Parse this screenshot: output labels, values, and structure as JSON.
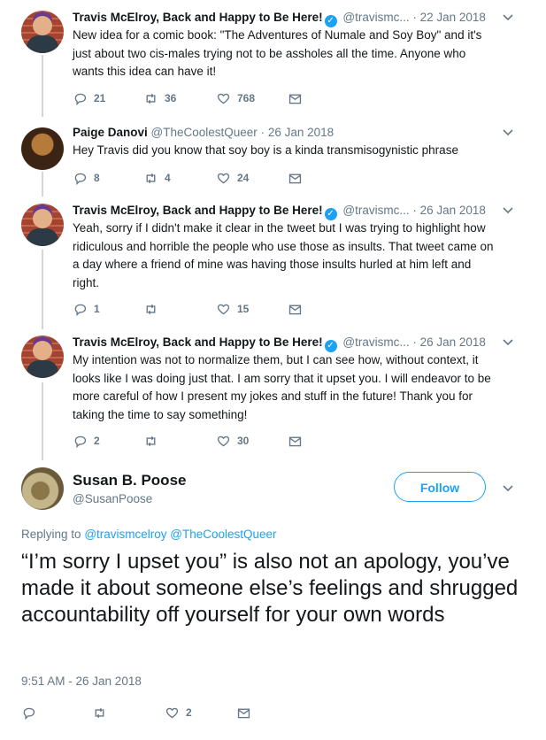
{
  "tweets": [
    {
      "name": "Travis McElroy, Back and Happy to Be Here!",
      "handle": "@travismc...",
      "date": "22 Jan 2018",
      "text": "New idea for a comic book: \"The Adventures of Numale and Soy Boy\" and it's just about two cis-males trying not to be assholes all the time. Anyone who wants this idea can have it!",
      "replies": "21",
      "retweets": "36",
      "likes": "768"
    },
    {
      "name": "Paige Danovi",
      "handle": "@TheCoolestQueer",
      "date": "26 Jan 2018",
      "text": "Hey Travis did you know that soy boy is a kinda transmisogynistic phrase",
      "replies": "8",
      "retweets": "4",
      "likes": "24"
    },
    {
      "name": "Travis McElroy, Back and Happy to Be Here!",
      "handle": "@travismc...",
      "date": "26 Jan 2018",
      "text": "Yeah, sorry if I didn't make it clear in the tweet but I was trying to highlight how ridiculous and horrible the people who use those as insults. That tweet came on a day where a friend of mine was having those insults hurled at him left and right.",
      "replies": "1",
      "retweets": "",
      "likes": "15"
    },
    {
      "name": "Travis McElroy, Back and Happy to Be Here!",
      "handle": "@travismc...",
      "date": "26 Jan 2018",
      "text": "My intention was not to normalize them, but I can see how, without context, it looks like I was doing just that. I am sorry that it upset you. I will endeavor to be more careful of how I present my jokes and stuff in the future! Thank you for taking the time to say something!",
      "replies": "2",
      "retweets": "",
      "likes": "30"
    }
  ],
  "main_tweet": {
    "name": "Susan B. Poose",
    "handle": "@SusanPoose",
    "follow_label": "Follow",
    "replying_prefix": "Replying to",
    "replying_to_1": "@travismcelroy",
    "replying_to_2": "@TheCoolestQueer",
    "text": "“I’m sorry I upset you” is also not an apology, you’ve made it about someone else’s feelings and shrugged accountability off yourself for your own words",
    "timestamp": "9:51 AM - 26 Jan 2018",
    "likes": "2"
  },
  "colors": {
    "accent": "#1da1f2",
    "muted": "#657786",
    "text": "#14171a",
    "line": "#ccd6dd"
  },
  "icons": [
    "reply-icon",
    "retweet-icon",
    "like-icon",
    "message-icon",
    "chevron-down-icon",
    "verified-icon"
  ]
}
